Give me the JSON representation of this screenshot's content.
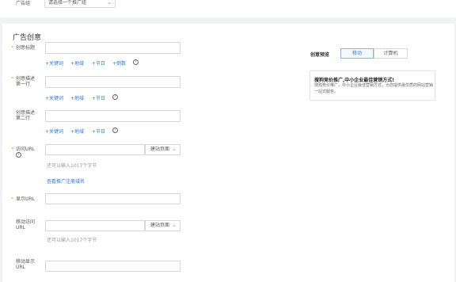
{
  "top": {
    "group_label": "广告组",
    "group_select": "请选择一个推广组"
  },
  "section": {
    "title": "广告创意"
  },
  "fields": {
    "title_label": "创意标题",
    "desc1_label_a": "创意描述",
    "desc1_label_b": "第一行",
    "desc2_label_a": "创意描述",
    "desc2_label_b": "第二行",
    "url_label": "访问URL",
    "display_url_label": "显示URL",
    "mobile_url_label_a": "移动访问",
    "mobile_url_label_b": "URL",
    "mobile_display_label_a": "移动显示",
    "mobile_display_label_b": "URL"
  },
  "insert_links": {
    "row1": [
      "+关键词",
      "+地域",
      "+节日",
      "+倒数"
    ],
    "row2": [
      "+关键词",
      "+地域",
      "+节日"
    ],
    "row3": [
      "+关键词",
      "+地域",
      "+节日"
    ]
  },
  "url_addon": "建站页面",
  "hint_chars": "还可以输入1017个字节",
  "register_domain_link": "查看推广注册域名",
  "preview": {
    "label": "创意预览",
    "tabs": [
      "移动",
      "计算机"
    ],
    "active_tab": "移动",
    "ad_title": "搜狗竞价推广,中小企业最佳营销方式!",
    "ad_desc": "搜狗竞价推广，中小企业最佳营销方式，为您提供最优质的网站营销一站式服务。"
  },
  "colors": {
    "accent": "#2d7be5",
    "required": "#f5a623",
    "background": "#f1f2f5"
  },
  "icons": {
    "help": "question-circle-icon",
    "dropdown": "chevron-down-icon"
  }
}
